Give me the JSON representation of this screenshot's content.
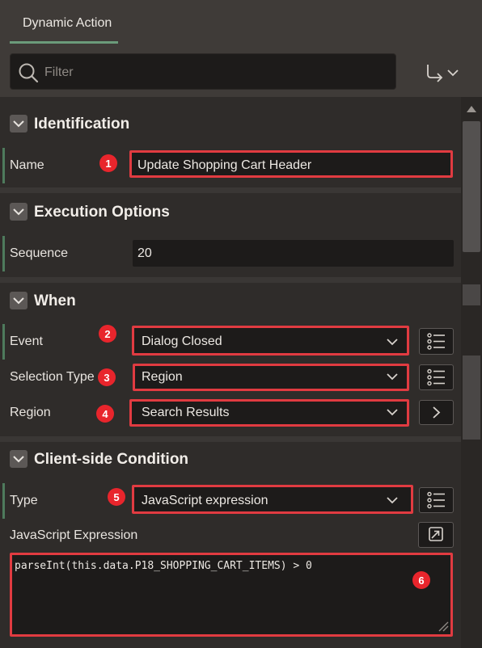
{
  "tabs": [
    {
      "label": "Dynamic Action"
    }
  ],
  "search": {
    "placeholder": "Filter"
  },
  "sections": {
    "identification": {
      "title": "Identification",
      "name_label": "Name",
      "name_value": "Update Shopping Cart Header",
      "badge": "1"
    },
    "execution": {
      "title": "Execution Options",
      "sequence_label": "Sequence",
      "sequence_value": "20"
    },
    "when": {
      "title": "When",
      "event_label": "Event",
      "event_value": "Dialog Closed",
      "event_badge": "2",
      "selection_type_label": "Selection Type",
      "selection_type_value": "Region",
      "selection_type_badge": "3",
      "region_label": "Region",
      "region_value": "Search Results",
      "region_badge": "4"
    },
    "condition": {
      "title": "Client-side Condition",
      "type_label": "Type",
      "type_value": "JavaScript expression",
      "type_badge": "5",
      "js_label": "JavaScript Expression",
      "js_value": "parseInt(this.data.P18_SHOPPING_CART_ITEMS) > 0",
      "js_badge": "6"
    }
  },
  "colors": {
    "highlight": "#e13b41",
    "badge": "#e8252c",
    "accent": "#6b9b7a"
  },
  "icons": [
    "search-icon",
    "goto-icon",
    "chevron-down-icon",
    "list-icon",
    "chevron-right-icon",
    "expand-icon",
    "resize-handle-icon"
  ]
}
